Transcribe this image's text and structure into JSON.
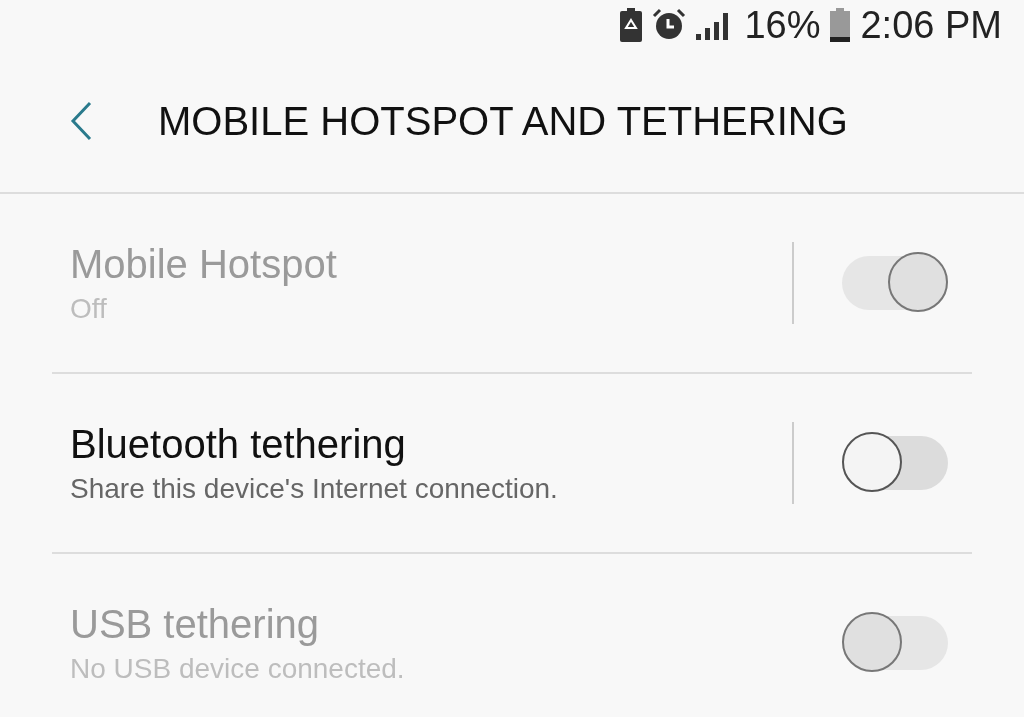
{
  "status_bar": {
    "battery_percent": "16%",
    "time": "2:06 PM"
  },
  "header": {
    "title": "MOBILE HOTSPOT AND TETHERING"
  },
  "settings": [
    {
      "title": "Mobile Hotspot",
      "subtitle": "Off",
      "on": true,
      "disabled": true,
      "divider": true
    },
    {
      "title": "Bluetooth tethering",
      "subtitle": "Share this device's Internet connection.",
      "on": false,
      "disabled": false,
      "divider": true
    },
    {
      "title": "USB tethering",
      "subtitle": "No USB device connected.",
      "on": false,
      "disabled": true,
      "divider": false
    }
  ]
}
